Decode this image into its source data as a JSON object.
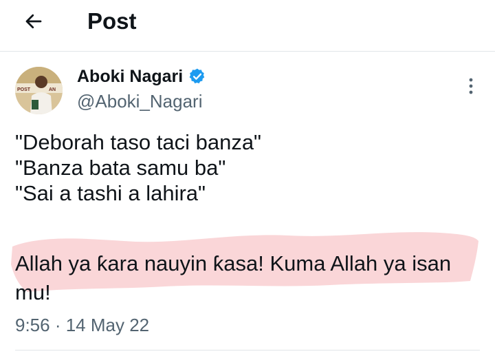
{
  "header": {
    "title": "Post",
    "back_icon": "arrow-left-icon"
  },
  "post": {
    "author": {
      "name": "Aboki Nagari",
      "handle": "@Aboki_Nagari",
      "verified": true,
      "verified_color": "#1d9bf0"
    },
    "lines": [
      "\"Deborah taso taci banza\"",
      "\"Banza bata samu ba\"",
      "\"Sai a tashi a lahira\""
    ],
    "highlighted_text_line1": "Allah ya ƙara nauyin ƙasa! Kuma Allah ya isan",
    "highlighted_text_line2": "mu!",
    "highlight_color": "#f9d2d4",
    "timestamp": "9:56 · 14 May 22"
  },
  "icons": {
    "more": "more-vertical-icon",
    "verified": "verified-badge-icon"
  }
}
